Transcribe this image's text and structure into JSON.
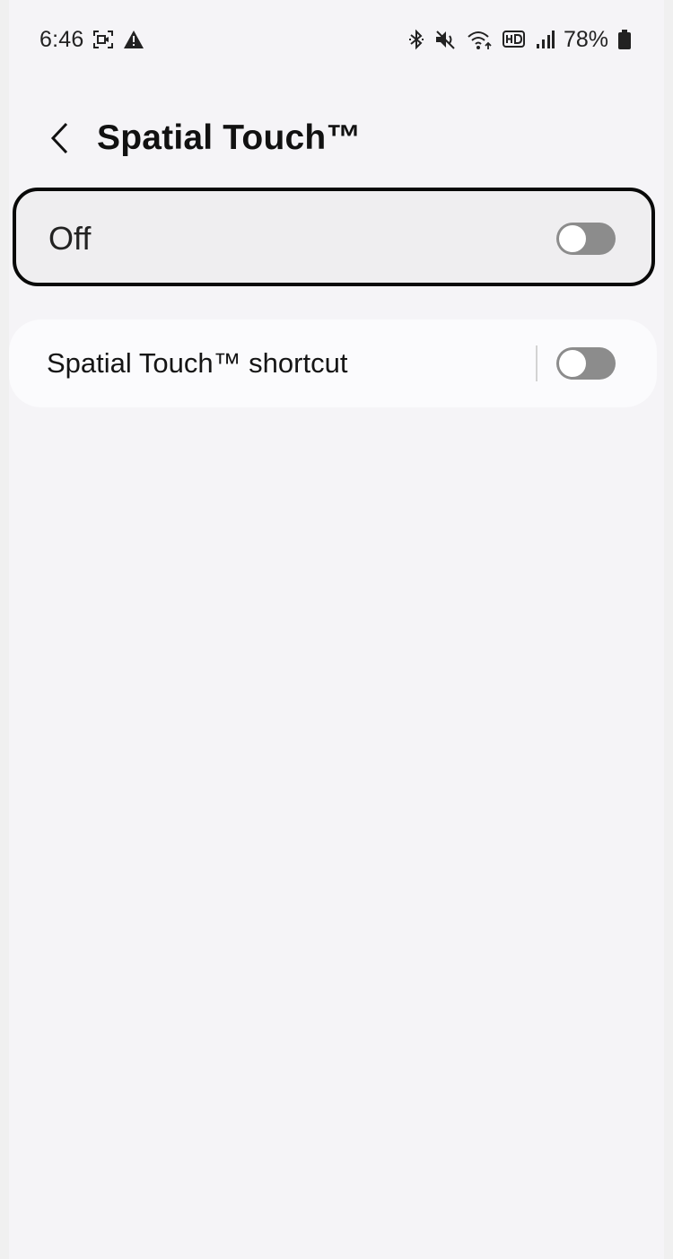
{
  "status_bar": {
    "time": "6:46",
    "battery_percent": "78%",
    "icons": [
      "screen-record-icon",
      "warning-icon",
      "bluetooth-icon",
      "mute-icon",
      "wifi-icon",
      "hd-voice-icon",
      "signal-icon",
      "battery-icon"
    ]
  },
  "header": {
    "title": "Spatial Touch™",
    "back_icon": "chevron-left-icon"
  },
  "master_switch": {
    "label": "Off",
    "enabled": false
  },
  "settings": [
    {
      "label": "Spatial Touch™ shortcut",
      "enabled": false
    }
  ],
  "colors": {
    "background": "#f5f4f7",
    "card": "#fbfbfd",
    "focused_card": "#efeef0",
    "focus_border": "#090909",
    "toggle_off": "#8c8c8c"
  }
}
